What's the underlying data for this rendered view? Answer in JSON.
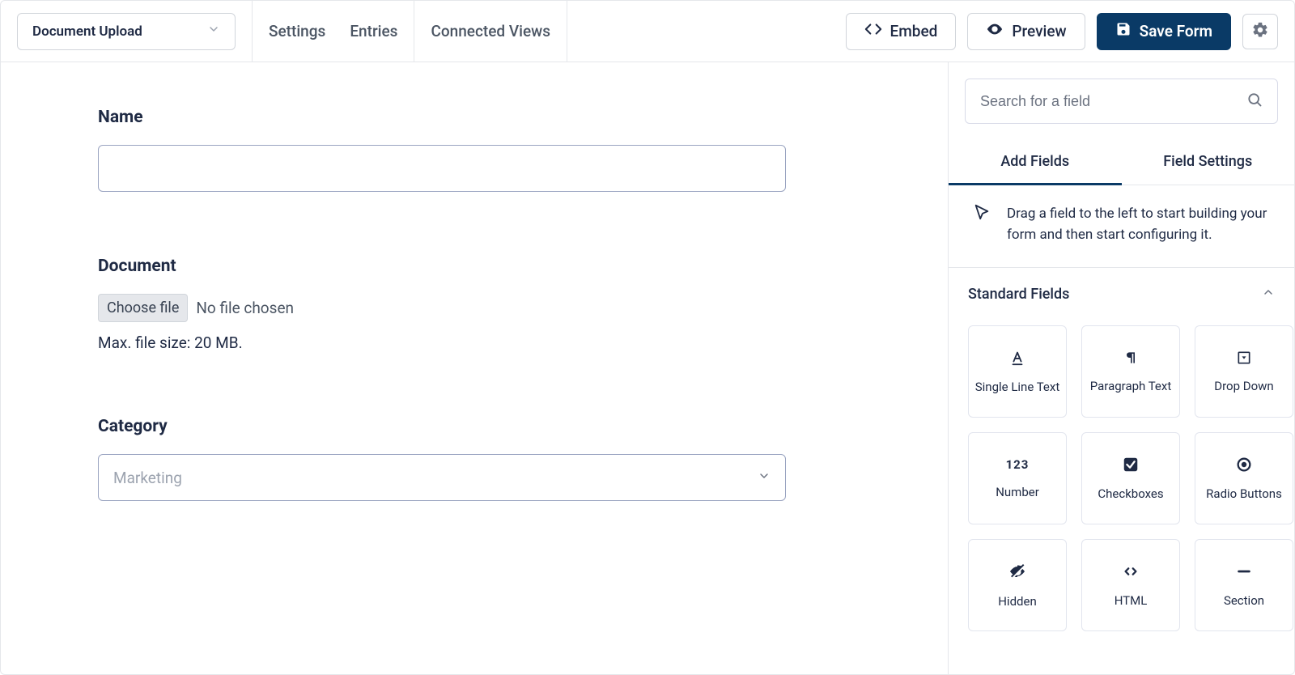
{
  "header": {
    "form_name": "Document Upload",
    "nav": {
      "settings": "Settings",
      "entries": "Entries",
      "connected_views": "Connected Views"
    },
    "buttons": {
      "embed": "Embed",
      "preview": "Preview",
      "save": "Save Form"
    }
  },
  "canvas": {
    "name": {
      "label": "Name",
      "value": ""
    },
    "document": {
      "label": "Document",
      "choose_button": "Choose file",
      "status_text": "No file chosen",
      "hint": "Max. file size: 20 MB."
    },
    "category": {
      "label": "Category",
      "selected": "Marketing"
    }
  },
  "sidebar": {
    "search_placeholder": "Search for a field",
    "tabs": {
      "add_fields": "Add Fields",
      "field_settings": "Field Settings"
    },
    "hint": "Drag a field to the left to start building your form and then start configuring it.",
    "section_title": "Standard Fields",
    "fields": [
      "Single Line Text",
      "Paragraph Text",
      "Drop Down",
      "Number",
      "Checkboxes",
      "Radio Buttons",
      "Hidden",
      "HTML",
      "Section"
    ]
  }
}
